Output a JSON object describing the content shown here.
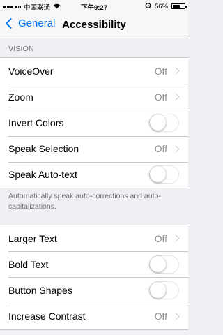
{
  "status_bar": {
    "carrier": "中国联通",
    "time": "下午9:27",
    "battery_percent": "56%",
    "battery_level": 0.56,
    "signal_bars": 4,
    "signal_total": 5
  },
  "nav": {
    "back_label": "General",
    "title": "Accessibility"
  },
  "vision": {
    "header": "VISION",
    "rows": [
      {
        "label": "VoiceOver",
        "value": "Off",
        "type": "disclosure"
      },
      {
        "label": "Zoom",
        "value": "Off",
        "type": "disclosure"
      },
      {
        "label": "Invert Colors",
        "type": "toggle",
        "on": false
      },
      {
        "label": "Speak Selection",
        "value": "Off",
        "type": "disclosure"
      },
      {
        "label": "Speak Auto-text",
        "type": "toggle",
        "on": false
      }
    ],
    "footer": "Automatically speak auto-corrections and auto-capitalizations."
  },
  "display": {
    "rows": [
      {
        "label": "Larger Text",
        "value": "Off",
        "type": "disclosure"
      },
      {
        "label": "Bold Text",
        "type": "toggle",
        "on": false
      },
      {
        "label": "Button Shapes",
        "type": "toggle",
        "on": false
      },
      {
        "label": "Increase Contrast",
        "value": "Off",
        "type": "disclosure"
      }
    ]
  }
}
